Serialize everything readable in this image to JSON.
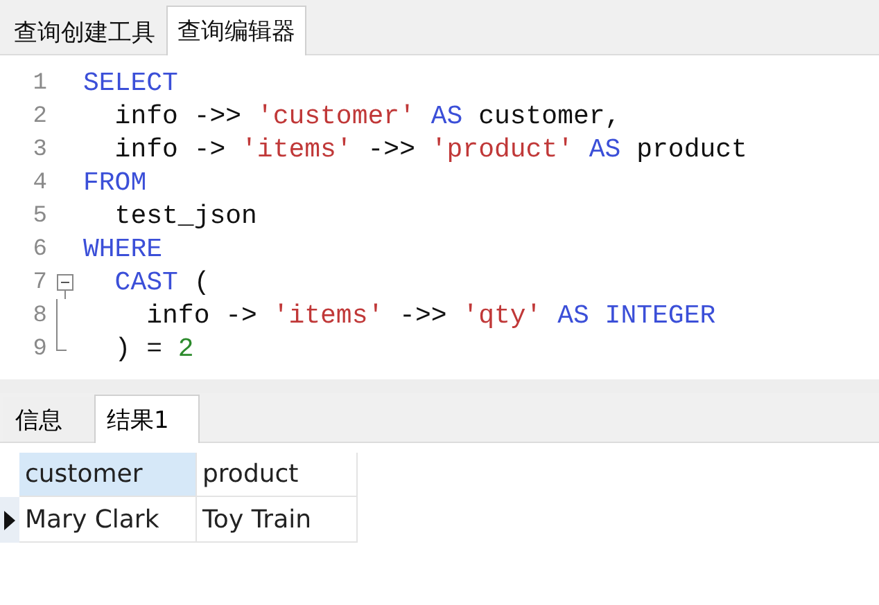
{
  "editor_tabs": [
    {
      "label": "查询创建工具",
      "selected": false
    },
    {
      "label": "查询编辑器",
      "selected": true
    }
  ],
  "code_lines": [
    {
      "number": "1",
      "kind": "plain",
      "tokens": [
        {
          "kind": "keyword",
          "text": "SELECT"
        }
      ]
    },
    {
      "number": "2",
      "kind": "plain",
      "tokens": [
        {
          "kind": "plain",
          "text": "  info ->> "
        },
        {
          "kind": "string",
          "text": "'customer'"
        },
        {
          "kind": "keyword",
          "text": " AS"
        },
        {
          "kind": "plain",
          "text": " customer,"
        }
      ]
    },
    {
      "number": "3",
      "kind": "plain",
      "tokens": [
        {
          "kind": "plain",
          "text": "  info -> "
        },
        {
          "kind": "string",
          "text": "'items'"
        },
        {
          "kind": "plain",
          "text": " ->> "
        },
        {
          "kind": "string",
          "text": "'product'"
        },
        {
          "kind": "keyword",
          "text": " AS"
        },
        {
          "kind": "plain",
          "text": " product"
        }
      ]
    },
    {
      "number": "4",
      "kind": "plain",
      "tokens": [
        {
          "kind": "keyword",
          "text": "FROM"
        }
      ]
    },
    {
      "number": "5",
      "kind": "plain",
      "tokens": [
        {
          "kind": "plain",
          "text": "  test_json"
        }
      ]
    },
    {
      "number": "6",
      "kind": "plain",
      "tokens": [
        {
          "kind": "keyword",
          "text": "WHERE"
        }
      ]
    },
    {
      "number": "7",
      "kind": "fold_start",
      "tokens": [
        {
          "kind": "keyword",
          "text": "  CAST"
        },
        {
          "kind": "plain",
          "text": " ("
        }
      ]
    },
    {
      "number": "8",
      "kind": "fold_middle",
      "tokens": [
        {
          "kind": "plain",
          "text": "    info -> "
        },
        {
          "kind": "string",
          "text": "'items'"
        },
        {
          "kind": "plain",
          "text": " ->> "
        },
        {
          "kind": "string",
          "text": "'qty'"
        },
        {
          "kind": "keyword",
          "text": " AS"
        },
        {
          "kind": "keyword",
          "text": " INTEGER"
        }
      ]
    },
    {
      "number": "9",
      "kind": "fold_end",
      "tokens": [
        {
          "kind": "plain",
          "text": "  ) = "
        },
        {
          "kind": "number",
          "text": "2"
        }
      ]
    }
  ],
  "result_tabs": [
    {
      "label": "信息",
      "selected": false
    },
    {
      "label": "结果1",
      "selected": true
    }
  ],
  "table": {
    "columns": [
      {
        "label": "customer",
        "selected": true
      },
      {
        "label": "product",
        "selected": false
      }
    ],
    "rows": [
      {
        "current": true,
        "cells": [
          "Mary Clark",
          "Toy Train"
        ]
      }
    ]
  }
}
